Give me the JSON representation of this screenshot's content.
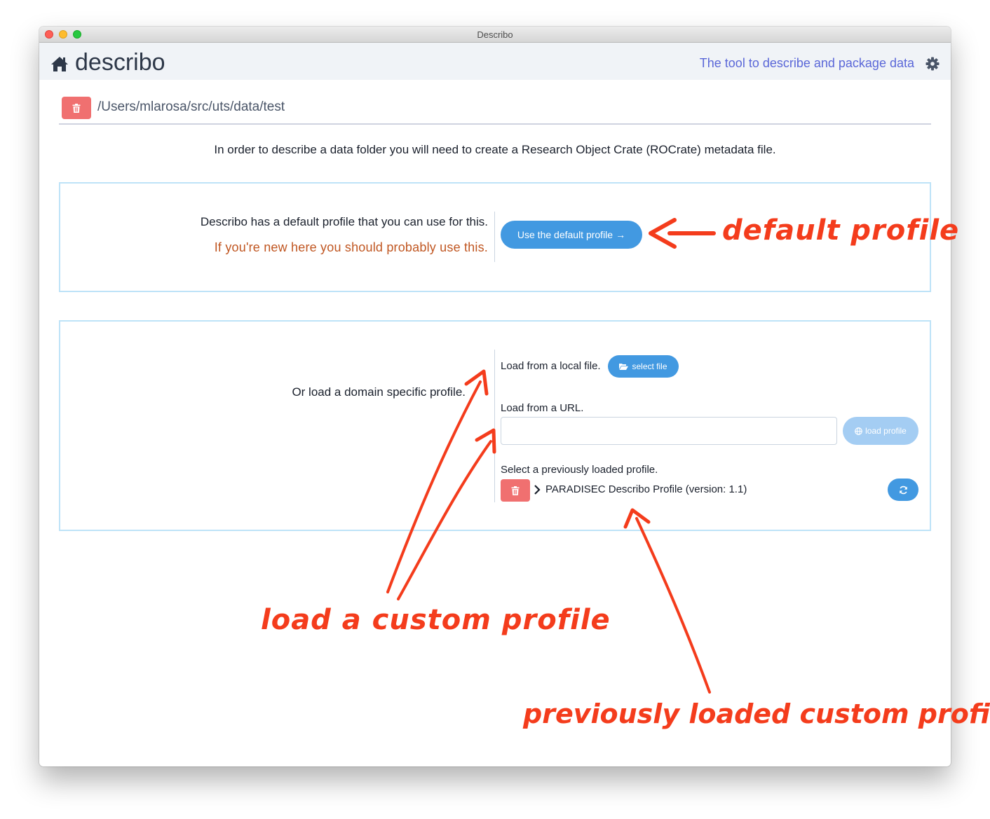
{
  "window": {
    "title": "Describo"
  },
  "navbar": {
    "brand": "describo",
    "tagline": "The tool to describe and package data"
  },
  "folder": {
    "path": "/Users/mlarosa/src/uts/data/test"
  },
  "intro": "In order to describe a data folder you will need to create a Research Object Crate (ROCrate) metadata file.",
  "default_panel": {
    "line1": "Describo has a default profile that you can use for this.",
    "line2": "If you're new here you should probably use this.",
    "button": "Use the default profile",
    "button_arrow": "→"
  },
  "domain_panel": {
    "left_label": "Or load a domain specific profile.",
    "local_file_label": "Load from a local file.",
    "select_file_button": "select file",
    "url_label": "Load from a URL.",
    "url_value": "",
    "load_profile_button": "load profile",
    "previous_label": "Select a previously loaded profile.",
    "previous_profiles": [
      "PARADISEC Describo Profile (version: 1.1)"
    ]
  },
  "annotations": {
    "default": "default profile",
    "custom": "load a custom profile",
    "previous": "previously loaded custom profiles"
  },
  "colors": {
    "primary": "#4299e1",
    "danger": "#f07070",
    "annotation": "#f43c1c",
    "warning_text": "#c05621"
  },
  "icons": [
    "home-icon",
    "gear-icon",
    "trash-icon",
    "folder-open-icon",
    "globe-icon",
    "chevron-right-icon",
    "refresh-icon"
  ]
}
